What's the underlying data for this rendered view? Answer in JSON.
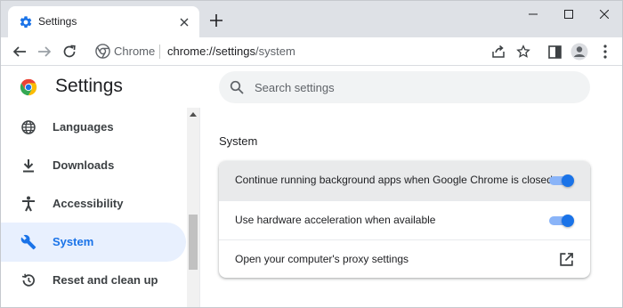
{
  "tab": {
    "title": "Settings",
    "favicon": "gear-icon"
  },
  "window_controls": [
    "minimize-icon",
    "maximize-icon",
    "close-icon"
  ],
  "toolbar": {
    "site_chip": "Chrome",
    "url_host": "chrome://settings",
    "url_path": "/system"
  },
  "page": {
    "title": "Settings",
    "search_placeholder": "Search settings",
    "nav": [
      {
        "label": "Languages",
        "icon": "globe-icon"
      },
      {
        "label": "Downloads",
        "icon": "download-icon"
      },
      {
        "label": "Accessibility",
        "icon": "accessibility-icon"
      },
      {
        "label": "System",
        "icon": "wrench-icon",
        "active": true
      },
      {
        "label": "Reset and clean up",
        "icon": "restore-icon"
      }
    ],
    "section_title": "System",
    "rows": [
      {
        "label": "Continue running background apps when Google Chrome is closed",
        "control": "toggle",
        "on": true
      },
      {
        "label": "Use hardware acceleration when available",
        "control": "toggle",
        "on": true
      },
      {
        "label": "Open your computer's proxy settings",
        "control": "external-link"
      }
    ]
  },
  "colors": {
    "accent": "#1a73e8",
    "active_nav_bg": "#e8f0fe",
    "tabstrip_bg": "#dee1e6"
  }
}
